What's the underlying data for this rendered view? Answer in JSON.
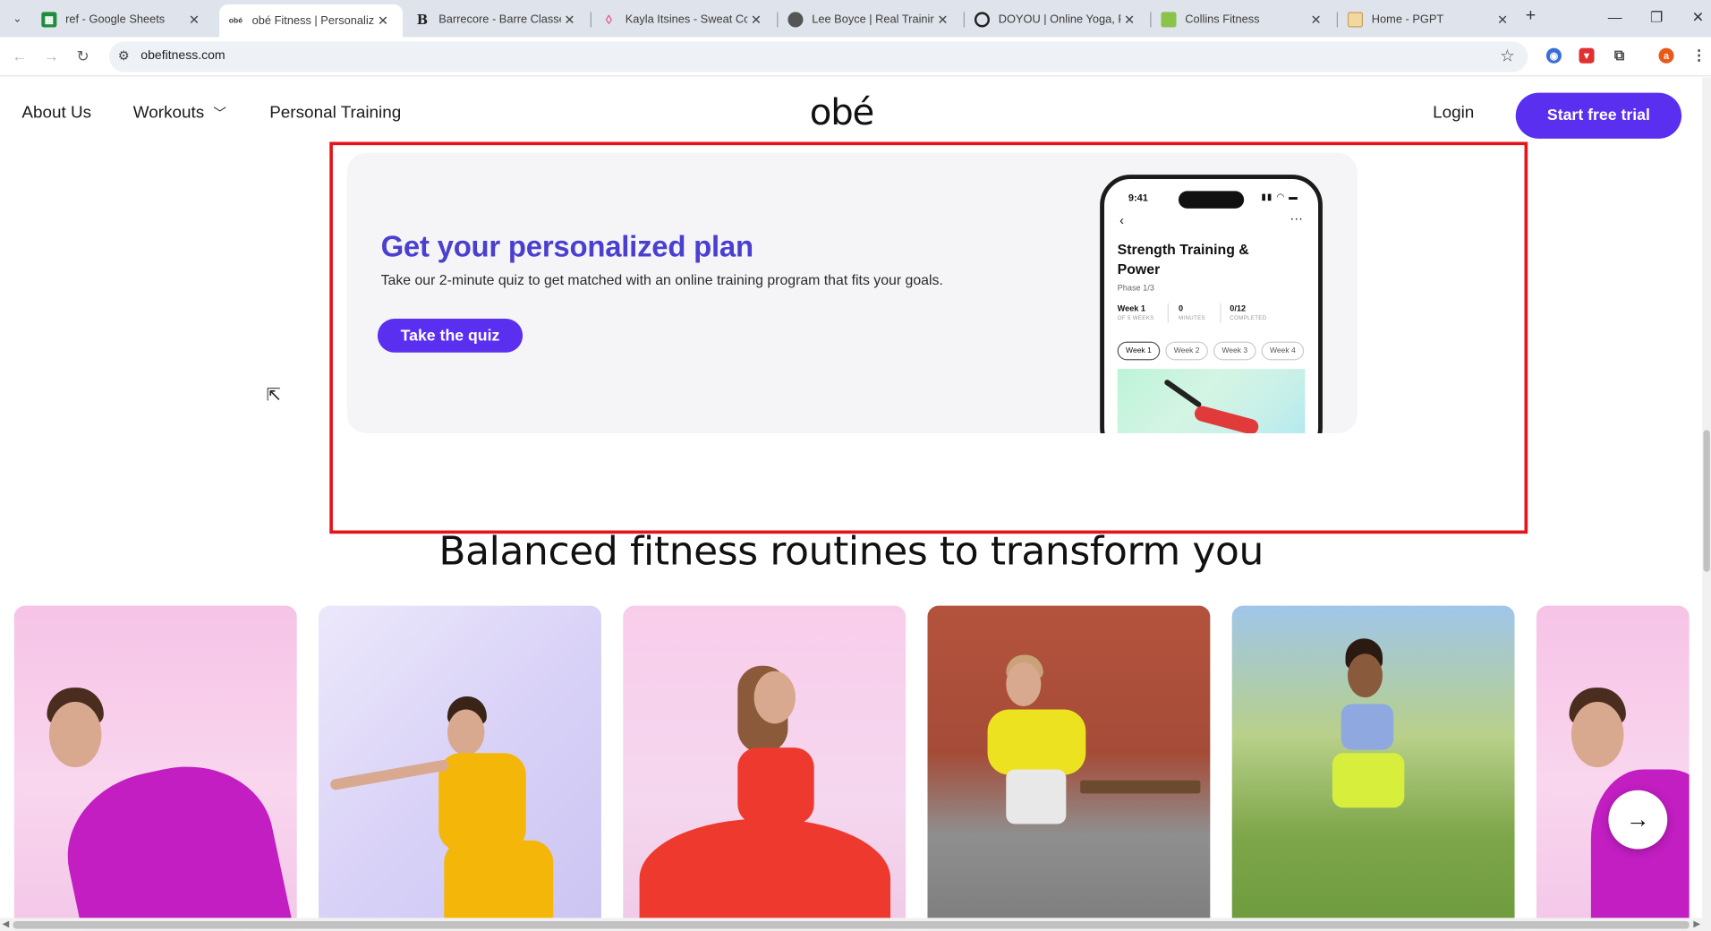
{
  "browser": {
    "tabs": [
      {
        "title": "ref - Google Sheets",
        "favicon": "sheets-icon",
        "color": "#1e8e3e"
      },
      {
        "title": "obé Fitness | Personalized",
        "favicon": "obe-icon",
        "color": "#ffffff",
        "active": true
      },
      {
        "title": "Barrecore - Barre Classes",
        "favicon": "barrecore-icon",
        "color": "#ffffff"
      },
      {
        "title": "Kayla Itsines - Sweat Co-F",
        "favicon": "sweat-drop-icon",
        "color": "#ffffff"
      },
      {
        "title": "Lee Boyce | Real Training.",
        "favicon": "person-icon",
        "color": "#ffffff"
      },
      {
        "title": "DOYOU | Online Yoga, Fit",
        "favicon": "doyou-icon",
        "color": "#ffffff"
      },
      {
        "title": "Collins Fitness",
        "favicon": "collins-icon",
        "color": "#8bc34a"
      },
      {
        "title": "Home - PGPT",
        "favicon": "folder-icon",
        "color": "#ffffff"
      }
    ],
    "url": "obefitness.com",
    "profile_initial": "a"
  },
  "site": {
    "nav": {
      "about": "About Us",
      "workouts": "Workouts",
      "personal_training": "Personal Training",
      "logo": "obé",
      "login": "Login",
      "cta": "Start free trial"
    },
    "plan_card": {
      "title": "Get your personalized plan",
      "subtitle": "Take our 2-minute quiz to get matched with an online training program that fits your goals.",
      "button": "Take the quiz"
    },
    "phone": {
      "time": "9:41",
      "program_title": "Strength Training & Power",
      "phase": "Phase 1/3",
      "stats": [
        {
          "value": "Week 1",
          "label": "OF 5 WEEKS"
        },
        {
          "value": "0",
          "label": "MINUTES"
        },
        {
          "value": "0/12",
          "label": "COMPLETED"
        }
      ],
      "weeks": [
        "Week 1",
        "Week 2",
        "Week 3",
        "Week 4"
      ]
    },
    "section_title": "Balanced fitness routines to transform you"
  },
  "colors": {
    "brand": "#5b2ff0",
    "title": "#4a3fcf",
    "highlight": "#e3151a"
  }
}
